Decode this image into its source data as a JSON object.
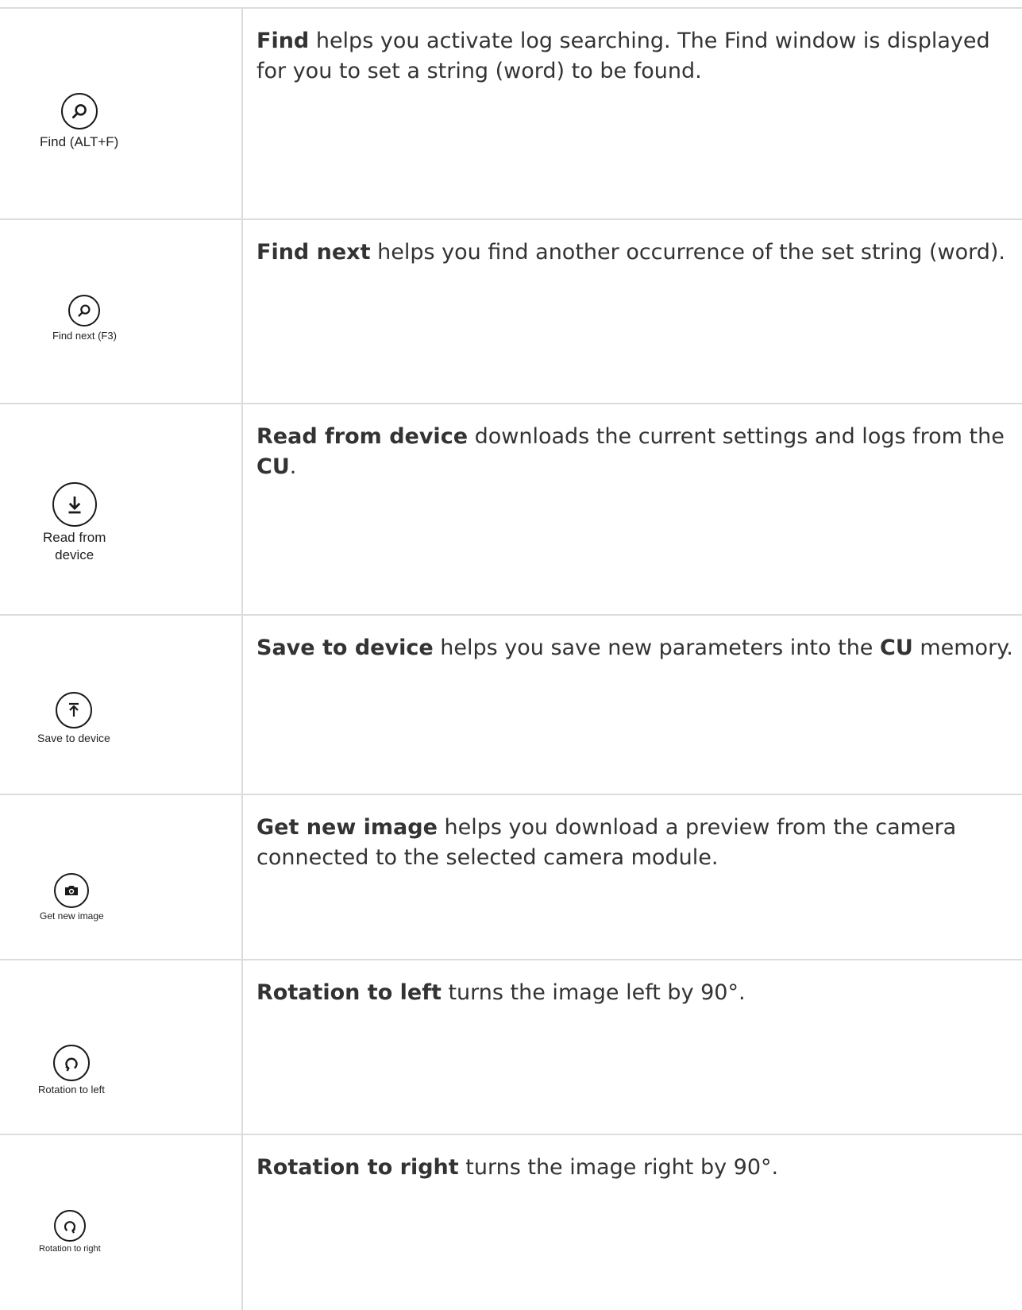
{
  "rows": [
    {
      "button_label": "Find (ALT+F)",
      "icon": "search-icon",
      "title": "Find",
      "text": " helps you activate log searching. The Find window is displayed for you to set a string (word) to be found."
    },
    {
      "button_label": "Find next (F3)",
      "icon": "search-icon",
      "title": "Find next",
      "text": " helps you find another occurrence of the set string (word)."
    },
    {
      "button_label_line1": "Read from",
      "button_label_line2": "device",
      "icon": "download-icon",
      "title": "Read from device",
      "text": " downloads the current settings and logs from the ",
      "bold2": "CU",
      "text2": "."
    },
    {
      "button_label": "Save to device",
      "icon": "upload-icon",
      "title": "Save to device",
      "text": " helps you save new parameters into the ",
      "bold2": "CU",
      "text2": " memory."
    },
    {
      "button_label": "Get new image",
      "icon": "camera-icon",
      "title": "Get new image",
      "text": " helps you download a preview from the camera connected to the selected camera module."
    },
    {
      "button_label": "Rotation to left",
      "icon": "rotate-left-icon",
      "title": "Rotation to left",
      "text": " turns the image left by 90°."
    },
    {
      "button_label": "Rotation to right",
      "icon": "rotate-right-icon",
      "title": "Rotation to right",
      "text": " turns the image right by 90°."
    }
  ]
}
